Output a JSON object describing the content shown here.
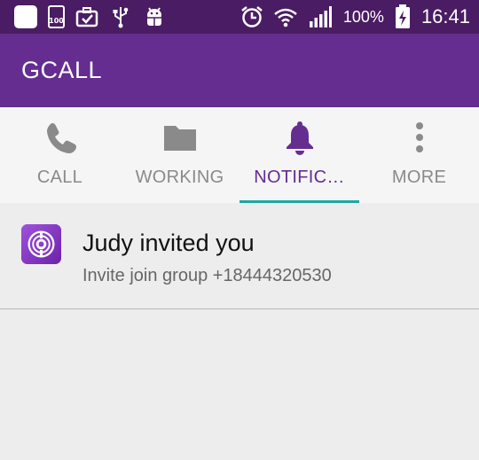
{
  "status_bar": {
    "battery_small_label": "100",
    "battery_percent": "100%",
    "time": "16:41",
    "icons": [
      "app-square-icon",
      "battery-100-icon",
      "briefcase-check-icon",
      "usb-icon",
      "android-debug-icon",
      "alarm-icon",
      "wifi-icon",
      "signal-icon",
      "battery-charging-icon"
    ]
  },
  "app_bar": {
    "title": "GCALL"
  },
  "tabs": [
    {
      "label": "CALL",
      "icon": "phone-icon",
      "active": false
    },
    {
      "label": "WORKING",
      "icon": "folder-icon",
      "active": false
    },
    {
      "label": "NOTIFIC…",
      "icon": "bell-icon",
      "active": true
    },
    {
      "label": "MORE",
      "icon": "more-vertical-icon",
      "active": false
    }
  ],
  "notifications": [
    {
      "title": "Judy invited you",
      "subtitle": "Invite join group +18444320530",
      "icon": "gcall-logo-icon"
    }
  ],
  "colors": {
    "status_bar": "#4a1c63",
    "app_bar": "#652d90",
    "tab_active": "#652d90",
    "tab_inactive": "#8a8a8a",
    "tab_indicator": "#1aa9a0",
    "background": "#ededed"
  }
}
